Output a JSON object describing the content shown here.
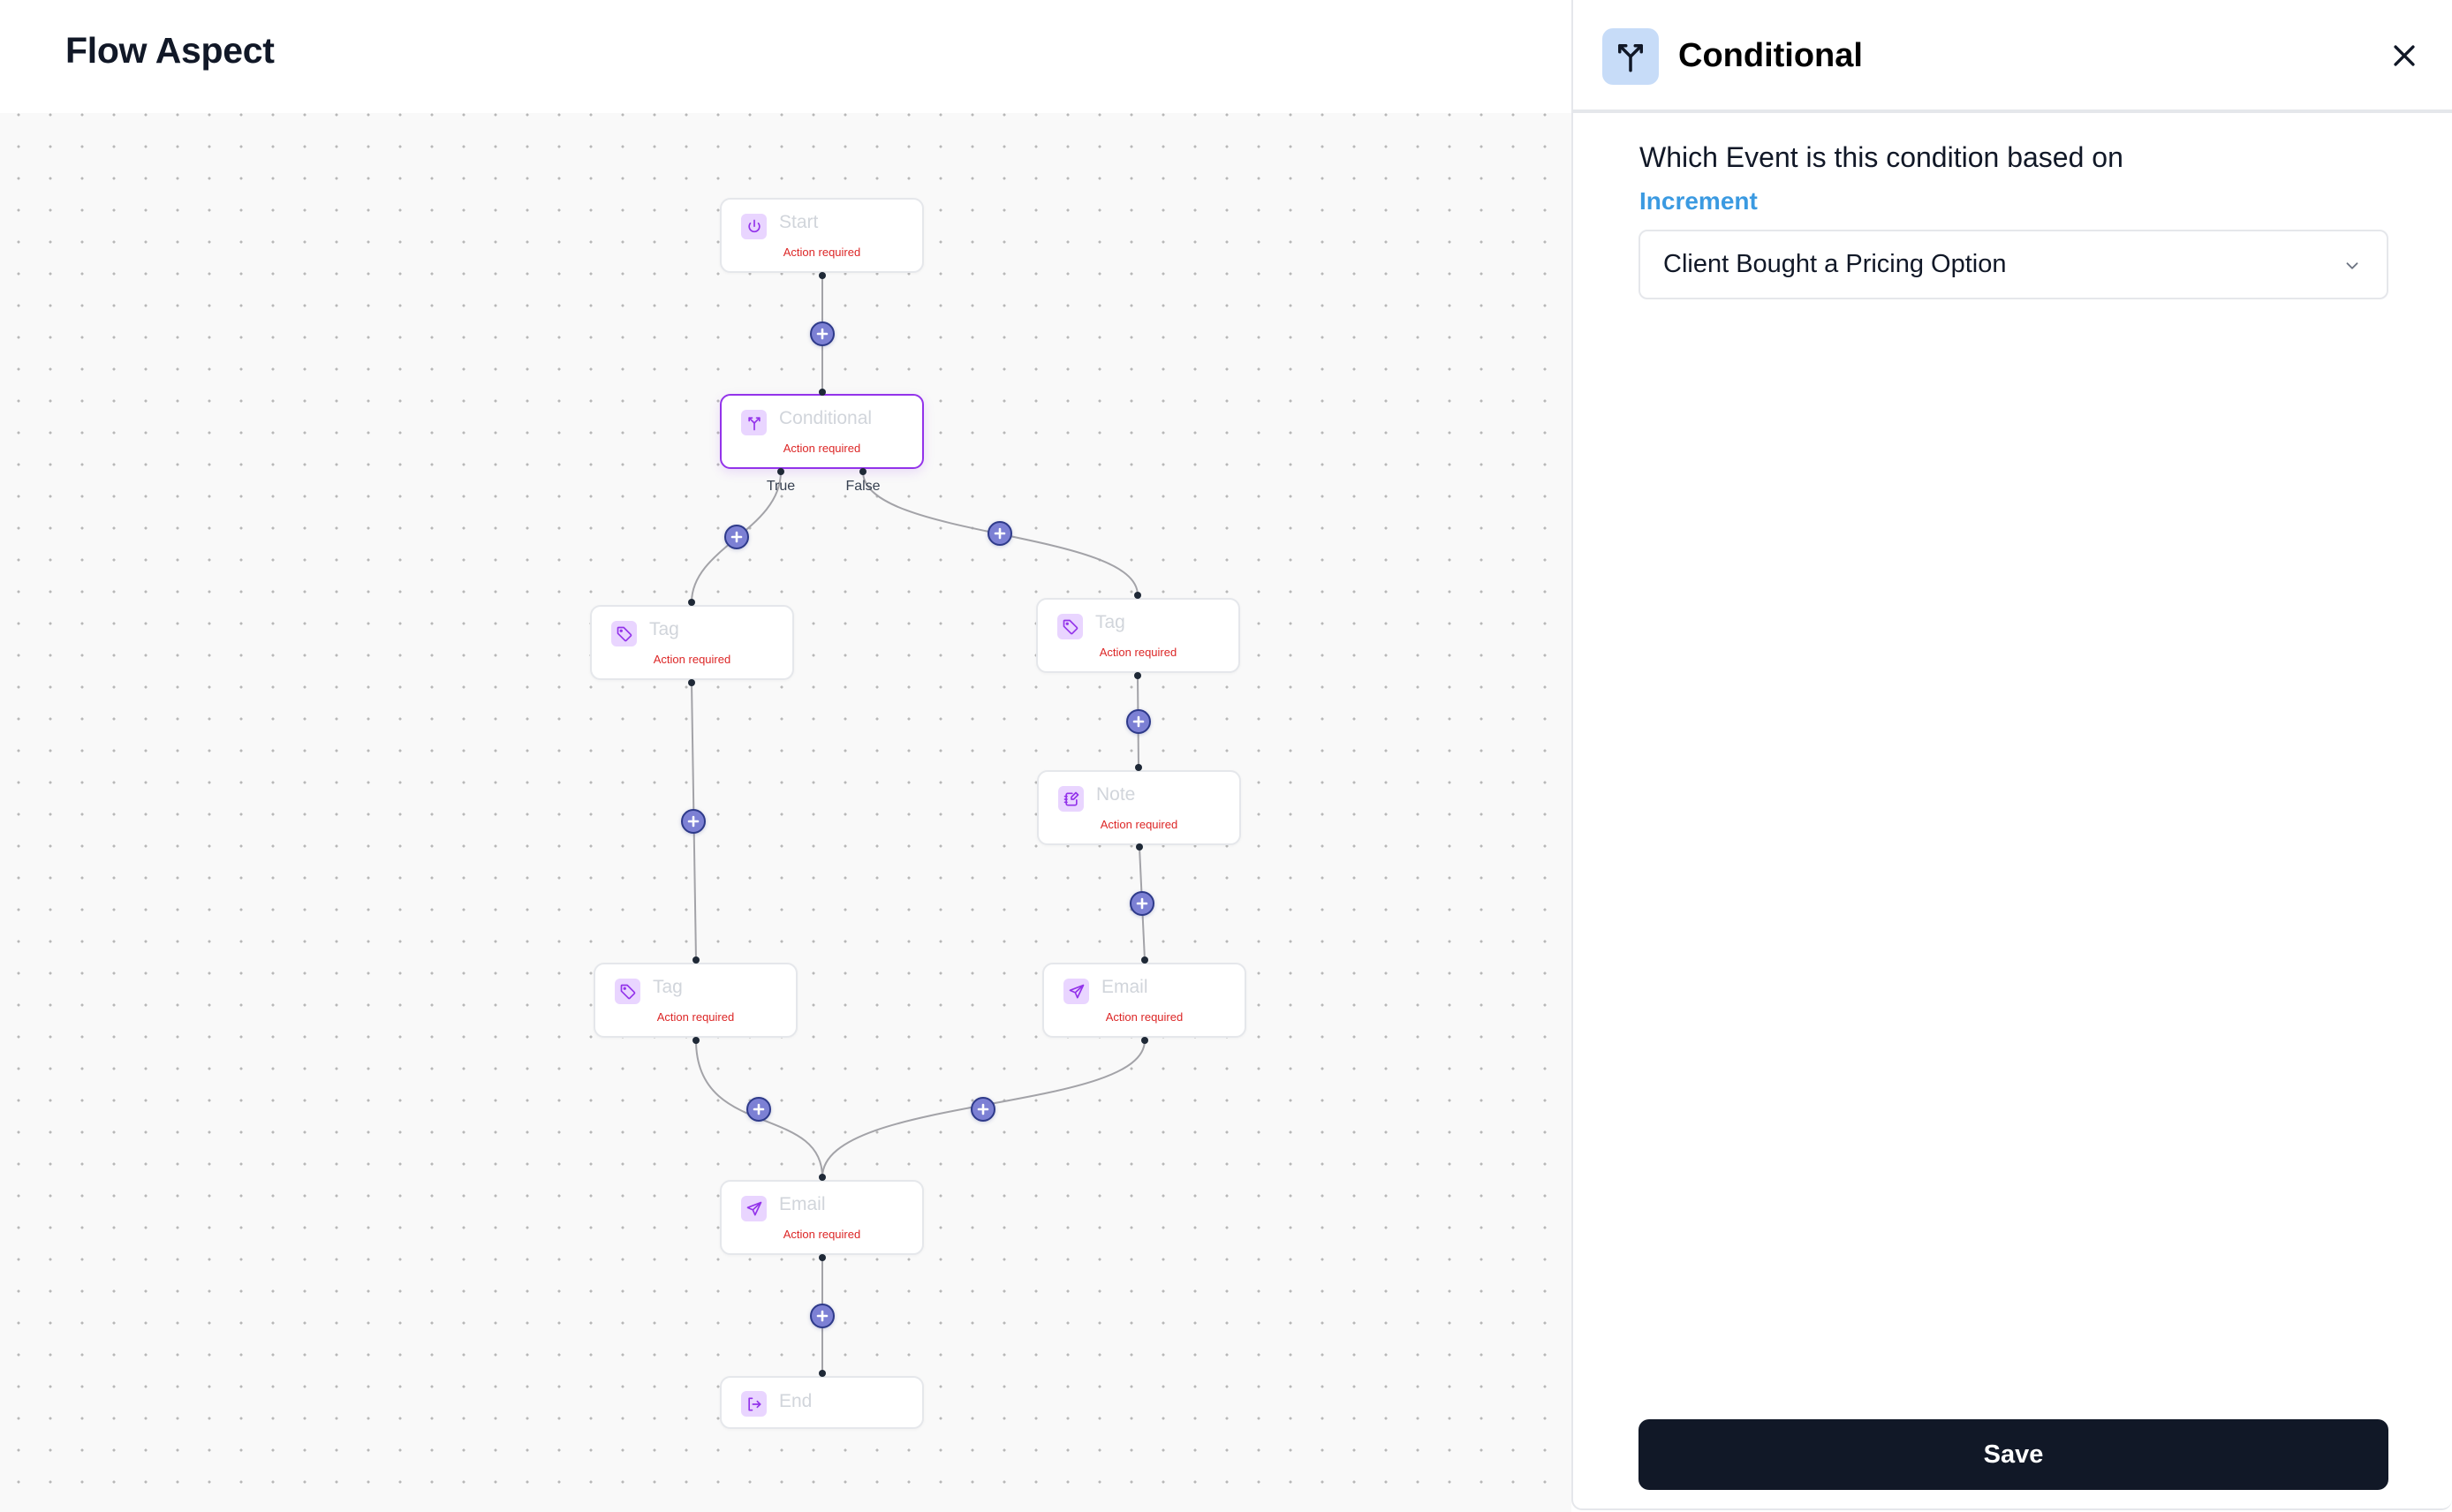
{
  "header": {
    "title": "Flow Aspect"
  },
  "flow": {
    "nodes": [
      {
        "id": "start",
        "label": "Start",
        "status": "Action required",
        "icon": "power-icon"
      },
      {
        "id": "conditional",
        "label": "Conditional",
        "status": "Action required",
        "icon": "split-icon",
        "selected": true
      },
      {
        "id": "tag-true",
        "label": "Tag",
        "status": "Action required",
        "icon": "tag-icon"
      },
      {
        "id": "tag-false",
        "label": "Tag",
        "status": "Action required",
        "icon": "tag-icon"
      },
      {
        "id": "note",
        "label": "Note",
        "status": "Action required",
        "icon": "note-icon"
      },
      {
        "id": "tag-true-2",
        "label": "Tag",
        "status": "Action required",
        "icon": "tag-icon"
      },
      {
        "id": "email-false",
        "label": "Email",
        "status": "Action required",
        "icon": "send-icon"
      },
      {
        "id": "email-merge",
        "label": "Email",
        "status": "Action required",
        "icon": "send-icon"
      },
      {
        "id": "end",
        "label": "End",
        "icon": "exit-icon"
      }
    ],
    "branch_labels": {
      "true": "True",
      "false": "False"
    },
    "edges": [
      [
        "start",
        "conditional"
      ],
      [
        "conditional:true",
        "tag-true"
      ],
      [
        "conditional:false",
        "tag-false"
      ],
      [
        "tag-true",
        "tag-true-2"
      ],
      [
        "tag-false",
        "note"
      ],
      [
        "note",
        "email-false"
      ],
      [
        "tag-true-2",
        "email-merge"
      ],
      [
        "email-false",
        "email-merge"
      ],
      [
        "email-merge",
        "end"
      ]
    ],
    "colors": {
      "accent": "#9333ea",
      "icon_bg": "#e9d5ff",
      "status": "#dc2626",
      "plus_fill": "#7c80d4",
      "plus_border": "#2e3a8a"
    }
  },
  "panel": {
    "title": "Conditional",
    "icon": "split-icon",
    "question": "Which Event is this condition based on",
    "link": "Increment",
    "select": {
      "value": "Client Bought a Pricing Option"
    },
    "save_label": "Save",
    "colors": {
      "icon_bg": "#c7dcf8",
      "link": "#3b9ae1",
      "save_bg": "#111827"
    }
  }
}
